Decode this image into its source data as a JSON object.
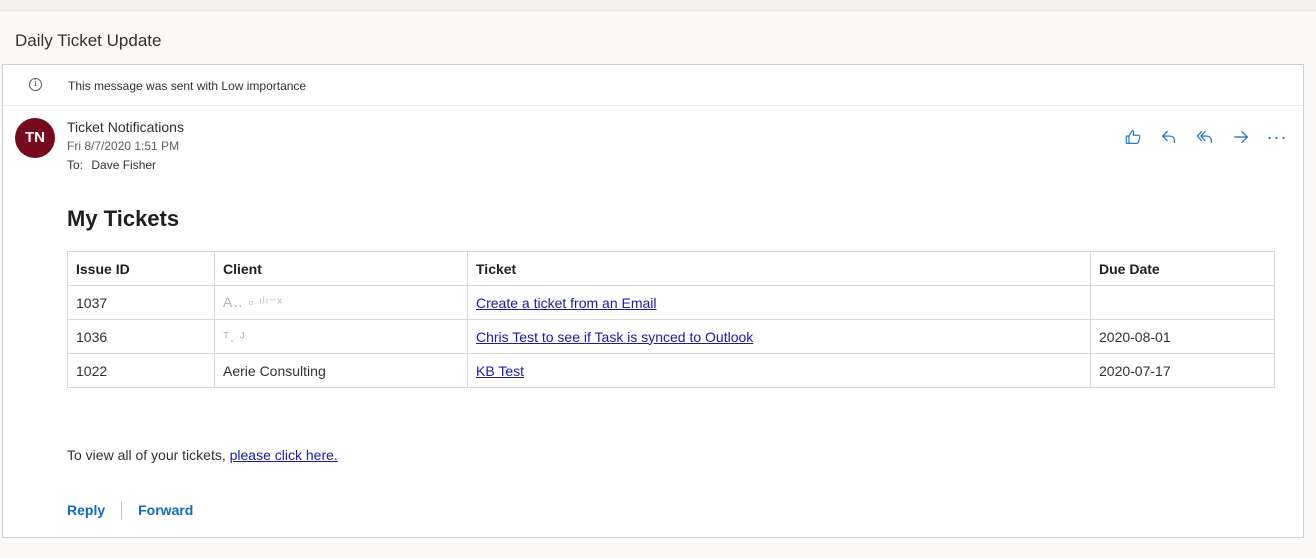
{
  "message": {
    "subject": "Daily Ticket Update",
    "importance_notice": "This message was sent with Low importance",
    "sender_initials": "TN",
    "sender_name": "Ticket Notifications",
    "date": "Fri 8/7/2020 1:51 PM",
    "to_label": "To:",
    "to_value": "Dave Fisher",
    "avatar_color": "#750b1c"
  },
  "actions": {
    "like_icon": "thumbs-up-icon",
    "reply_icon": "reply-icon",
    "reply_all_icon": "reply-all-icon",
    "forward_icon": "forward-icon",
    "more_label": "···"
  },
  "body": {
    "title": "My Tickets",
    "table": {
      "headers": [
        "Issue ID",
        "Client",
        "Ticket",
        "Due Date"
      ],
      "rows": [
        {
          "issue_id": "1037",
          "client": "A‥ ▫ ᶦˡᶦ⁻ˣ",
          "ticket": "Create a ticket from an Email",
          "due_date": ""
        },
        {
          "issue_id": "1036",
          "client": "ᵀ. ᴶ",
          "ticket": "Chris Test to see if Task is synced to Outlook",
          "due_date": "2020-08-01"
        },
        {
          "issue_id": "1022",
          "client": "Aerie Consulting",
          "ticket": "KB Test",
          "due_date": "2020-07-17"
        }
      ]
    },
    "footer_prefix": "To view all of your tickets,",
    "footer_link": "please click here."
  },
  "reply_bar": {
    "reply_label": "Reply",
    "forward_label": "Forward"
  },
  "colors": {
    "accent": "#0f6cbd",
    "link": "#1a1aa6"
  }
}
